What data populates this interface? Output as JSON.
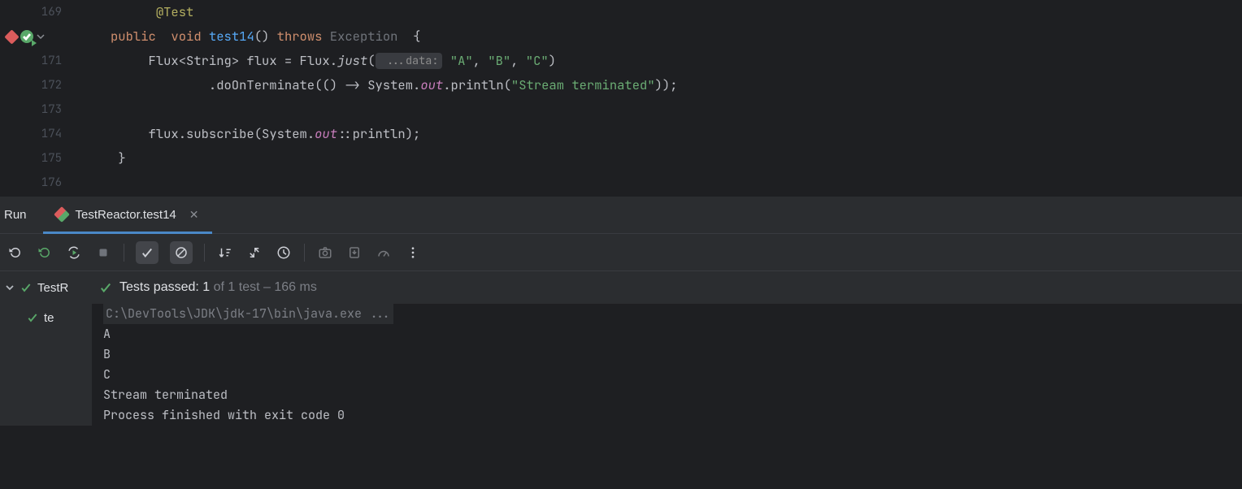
{
  "editor": {
    "lines": [
      {
        "num": "169"
      },
      {
        "num": ""
      },
      {
        "num": "171"
      },
      {
        "num": "172"
      },
      {
        "num": "173"
      },
      {
        "num": "174"
      },
      {
        "num": "175"
      },
      {
        "num": "176"
      }
    ],
    "code": {
      "ann": "@Test",
      "kw_public": "public",
      "kw_void": "void",
      "method": "test14",
      "kw_throws": "throws",
      "exception": "Exception",
      "l171a": "Flux<String> flux = Flux.",
      "l171_just": "just",
      "l171b": "(",
      "hint": " ...data:",
      "l171c": " ",
      "str_a": "\"A\"",
      "l171d": ", ",
      "str_b": "\"B\"",
      "l171e": ", ",
      "str_c": "\"C\"",
      "l171f": ")",
      "l172a": ".doOnTerminate(() -> System.",
      "field_out1": "out",
      "l172b": ".println(",
      "str_term": "\"Stream terminated\"",
      "l172c": "));",
      "l174a": "flux.subscribe(System.",
      "field_out2": "out",
      "l174b": "::println);",
      "brace_open": "{",
      "brace_close": "}"
    }
  },
  "run": {
    "title": "Run",
    "tab": "TestReactor.test14",
    "tree_root": "TestR",
    "tree_child": "te",
    "status": {
      "prefix": "Tests passed: ",
      "count": "1",
      "suffix": " of 1 test – 166 ms"
    },
    "console": [
      "C:\\DevTools\\JDK\\jdk-17\\bin\\java.exe ...",
      "A",
      "B",
      "C",
      "Stream terminated",
      "",
      "Process finished with exit code 0"
    ]
  }
}
